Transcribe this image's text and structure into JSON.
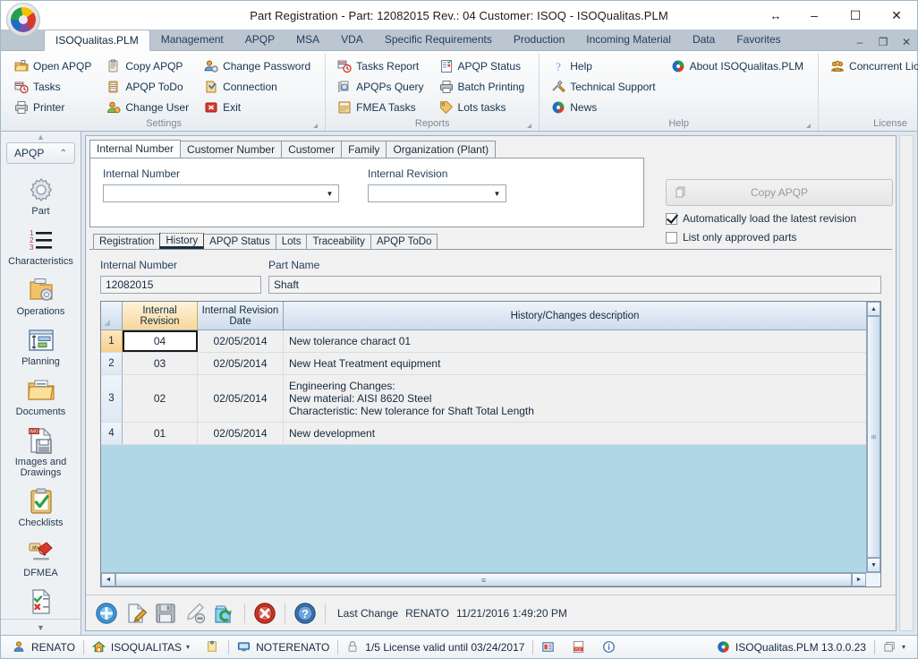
{
  "window": {
    "title": "Part Registration - Part: 12082015 Rev.: 04 Customer: ISOQ - ISOQualitas.PLM",
    "resize_glyph": "↔",
    "minimize_glyph": "–",
    "maximize_glyph": "☐",
    "close_glyph": "✕"
  },
  "ribbon": {
    "tabs": [
      {
        "label": "ISOQualitas.PLM",
        "active": true
      },
      {
        "label": "Management",
        "active": false
      },
      {
        "label": "APQP",
        "active": false
      },
      {
        "label": "MSA",
        "active": false
      },
      {
        "label": "VDA",
        "active": false
      },
      {
        "label": "Specific Requirements",
        "active": false
      },
      {
        "label": "Production",
        "active": false
      },
      {
        "label": "Incoming Material",
        "active": false
      },
      {
        "label": "Data",
        "active": false
      },
      {
        "label": "Favorites",
        "active": false
      }
    ],
    "mdi": {
      "minimize": "–",
      "restore": "❐",
      "close": "✕"
    },
    "groups": [
      {
        "label": "Settings",
        "columns": [
          [
            {
              "label": "Open APQP",
              "icon": "open-folder-icon"
            },
            {
              "label": "Tasks",
              "icon": "tasks-clock-icon"
            },
            {
              "label": "Printer",
              "icon": "printer-icon"
            }
          ],
          [
            {
              "label": "Copy APQP",
              "icon": "clipboard-copy-icon"
            },
            {
              "label": "APQP ToDo",
              "icon": "clipboard-list-icon"
            },
            {
              "label": "Change User",
              "icon": "change-user-icon"
            }
          ],
          [
            {
              "label": "Change Password",
              "icon": "change-password-icon"
            },
            {
              "label": "Connection",
              "icon": "connection-icon"
            },
            {
              "label": "Exit",
              "icon": "exit-icon"
            }
          ]
        ]
      },
      {
        "label": "Reports",
        "columns": [
          [
            {
              "label": "Tasks Report",
              "icon": "tasks-report-icon"
            },
            {
              "label": "APQPs Query",
              "icon": "query-icon"
            },
            {
              "label": "FMEA Tasks",
              "icon": "fmea-tasks-icon"
            }
          ],
          [
            {
              "label": "APQP Status",
              "icon": "apqp-status-icon"
            },
            {
              "label": "Batch Printing",
              "icon": "batch-printing-icon"
            },
            {
              "label": "Lots tasks",
              "icon": "lots-tasks-icon"
            }
          ]
        ]
      },
      {
        "label": "Help",
        "columns": [
          [
            {
              "label": "Help",
              "icon": "help-question-icon"
            },
            {
              "label": "Technical Support",
              "icon": "technical-support-icon"
            },
            {
              "label": "News",
              "icon": "news-icon"
            }
          ],
          [
            {
              "label": "About ISOQualitas.PLM",
              "icon": "about-icon"
            }
          ]
        ]
      },
      {
        "label": "License",
        "columns": [
          [
            {
              "label": "Concurrent Licenses",
              "icon": "concurrent-licenses-icon"
            }
          ]
        ]
      }
    ]
  },
  "sidebar": {
    "header": "APQP",
    "collapse_glyph": "⌃",
    "scroll_up_glyph": "▲",
    "scroll_down_glyph": "▼",
    "items": [
      {
        "label": "Part",
        "icon": "gear-icon"
      },
      {
        "label": "Characteristics",
        "icon": "numbered-list-icon"
      },
      {
        "label": "Operations",
        "icon": "folder-gear-icon"
      },
      {
        "label": "Planning",
        "icon": "planning-icon"
      },
      {
        "label": "Documents",
        "icon": "documents-folder-icon"
      },
      {
        "label": "Images and Drawings",
        "icon": "images-drawings-icon"
      },
      {
        "label": "Checklists",
        "icon": "checklist-clipboard-icon"
      },
      {
        "label": "DFMEA",
        "icon": "dfmea-marker-icon"
      },
      {
        "label": "",
        "icon": "check-cross-document-icon"
      }
    ]
  },
  "search_tabs": {
    "tabs": [
      {
        "label": "Internal Number",
        "active": true
      },
      {
        "label": "Customer Number",
        "active": false
      },
      {
        "label": "Customer",
        "active": false
      },
      {
        "label": "Family",
        "active": false
      },
      {
        "label": "Organization (Plant)",
        "active": false
      }
    ],
    "internal_number_label": "Internal Number",
    "internal_number_value": "",
    "internal_revision_label": "Internal Revision",
    "internal_revision_value": "",
    "dropdown_glyph": "▼"
  },
  "actions": {
    "copy_apqp_label": "Copy APQP",
    "copy_apqp_icon": "copy-stack-icon",
    "checkboxes": [
      {
        "label": "Automatically load the latest revision",
        "checked": true
      },
      {
        "label": "List only approved parts",
        "checked": false
      }
    ]
  },
  "detail_tabs": [
    {
      "label": "Registration",
      "active": false
    },
    {
      "label": "History",
      "active": true
    },
    {
      "label": "APQP Status",
      "active": false
    },
    {
      "label": "Lots",
      "active": false
    },
    {
      "label": "Traceability",
      "active": false
    },
    {
      "label": "APQP ToDo",
      "active": false
    }
  ],
  "detail_fields": {
    "internal_number_label": "Internal Number",
    "internal_number_value": "12082015",
    "part_name_label": "Part Name",
    "part_name_value": "Shaft"
  },
  "grid": {
    "columns": [
      "",
      "Internal Revision",
      "Internal Revision Date",
      "History/Changes description"
    ],
    "rows": [
      {
        "num": "1",
        "revision": "04",
        "date": "02/05/2014",
        "description": "New tolerance charact 01",
        "selected": true
      },
      {
        "num": "2",
        "revision": "03",
        "date": "02/05/2014",
        "description": "New Heat Treatment equipment",
        "selected": false
      },
      {
        "num": "3",
        "revision": "02",
        "date": "02/05/2014",
        "description": "Engineering Changes:\nNew material: AISI 8620 Steel\nCharacteristic: New tolerance for Shaft Total Length",
        "selected": false
      },
      {
        "num": "4",
        "revision": "01",
        "date": "02/05/2014",
        "description": "New development",
        "selected": false
      }
    ],
    "scroll": {
      "up_glyph": "▲",
      "down_glyph": "▼",
      "left_glyph": "◄",
      "right_glyph": "►",
      "grip_glyph": "≡"
    }
  },
  "bottom_toolbar": {
    "buttons": [
      {
        "icon": "add-icon",
        "name": "add-button"
      },
      {
        "icon": "edit-pencil-icon",
        "name": "edit-button"
      },
      {
        "icon": "save-disk-icon",
        "name": "save-button"
      },
      {
        "icon": "cancel-pencil-icon",
        "name": "cancel-edit-button"
      },
      {
        "icon": "refresh-icon",
        "name": "refresh-button"
      },
      {
        "icon": "delete-icon",
        "name": "delete-button"
      },
      {
        "icon": "help-icon",
        "name": "help-button"
      }
    ],
    "last_change_label": "Last Change",
    "last_change_user": "RENATO",
    "last_change_datetime": "11/21/2016 1:49:20 PM"
  },
  "statusbar": {
    "user": "RENATO",
    "user_icon": "user-icon",
    "organization": "ISOQUALITAS",
    "organization_icon": "home-icon",
    "organization_caret": "▾",
    "note_icon": "note-icon",
    "machine": "NOTERENATO",
    "machine_icon": "monitor-icon",
    "license_text": "1/5 License valid until 03/24/2017",
    "license_icon": "lock-icon",
    "report_icon": "report-icon",
    "pdf_icon": "pdf-icon",
    "info_icon": "info-icon",
    "version": "ISOQualitas.PLM 13.0.0.23",
    "version_icon": "app-logo-icon",
    "window_list_icon": "window-list-icon",
    "window_list_caret": "▾"
  },
  "colors": {
    "accent_blue": "#1c6fc0",
    "highlight_orange": "#f6d79b",
    "grid_empty_bg": "#b0d7e5",
    "ribbon_tabbar": "#bcc6d0"
  }
}
